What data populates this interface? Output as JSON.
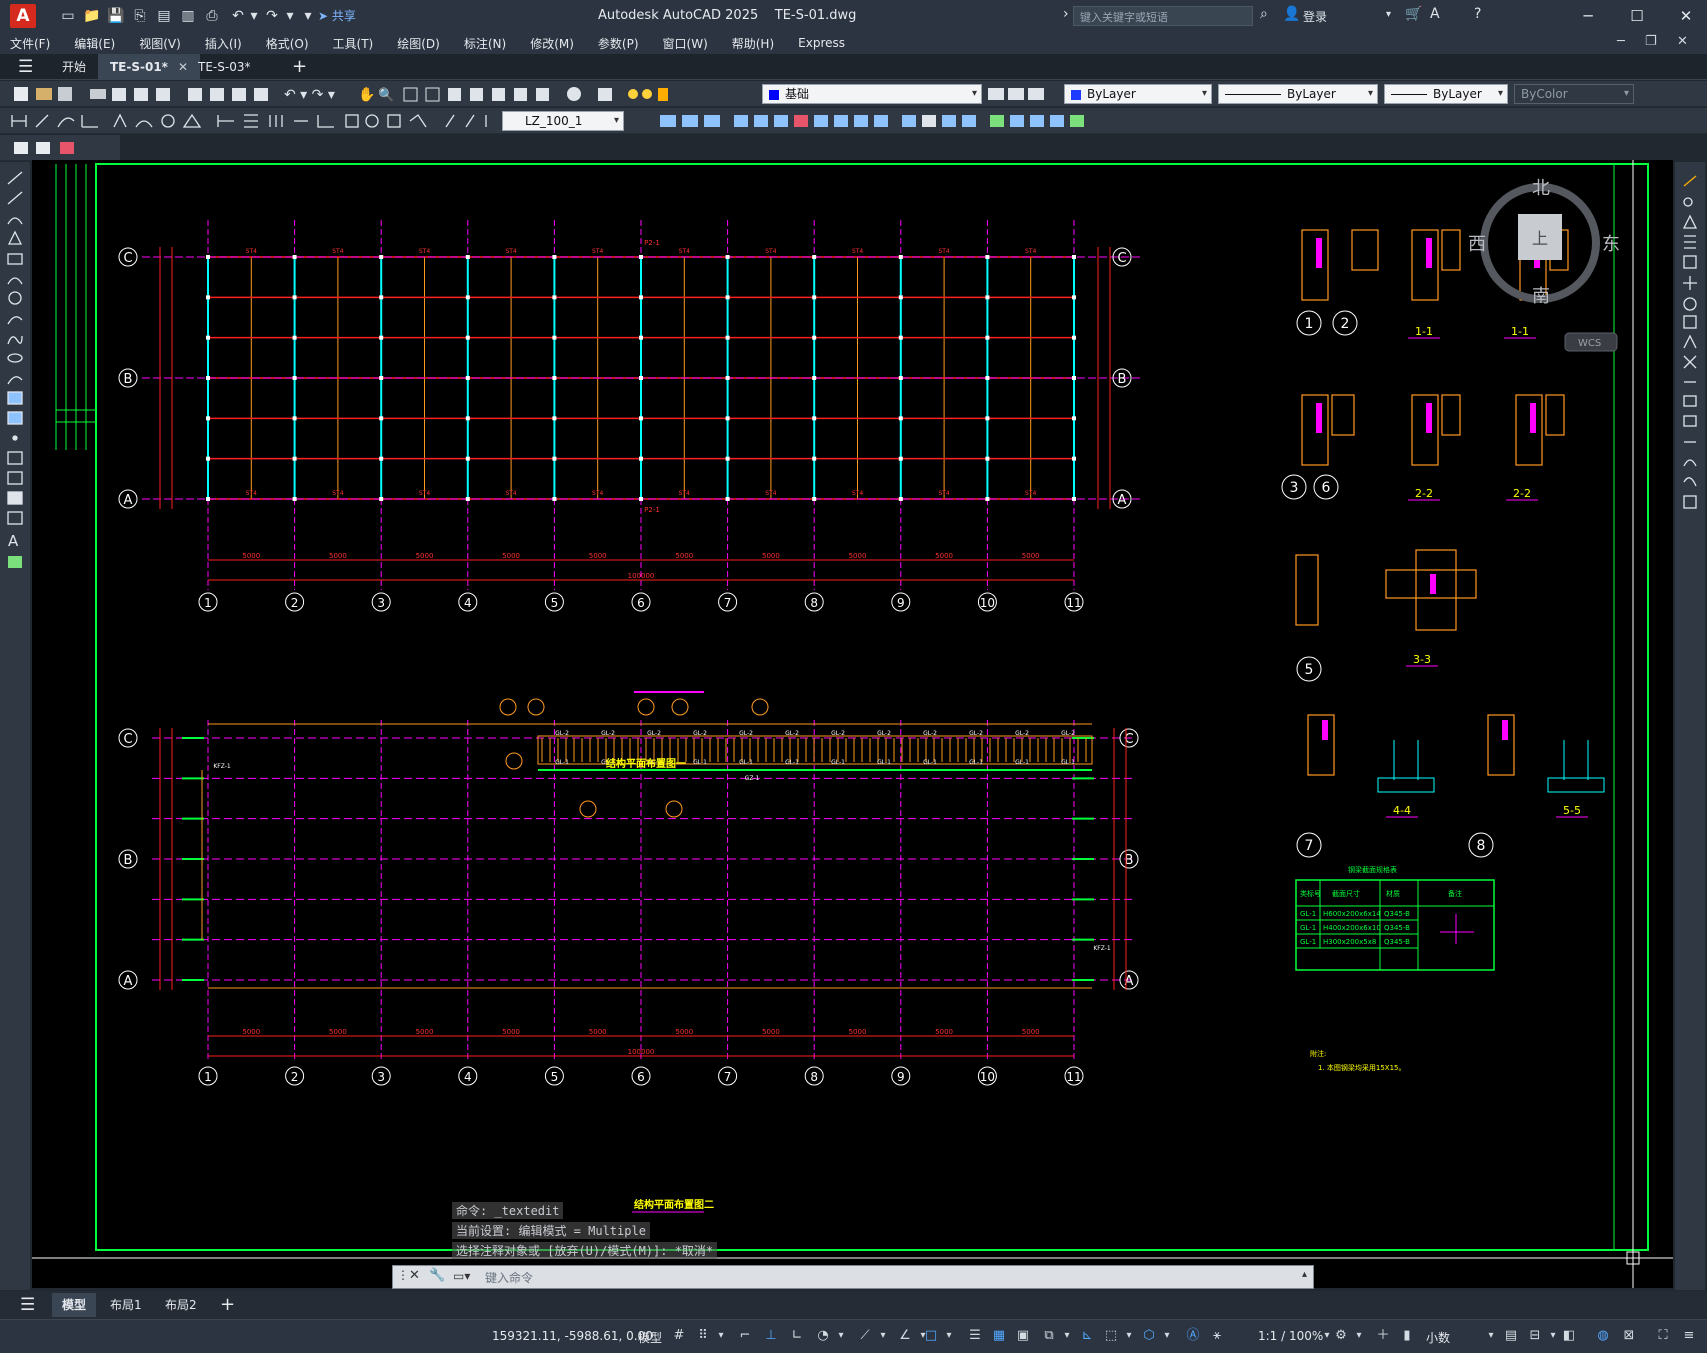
{
  "titlebar": {
    "logo": "A",
    "app_title": "Autodesk AutoCAD 2025    TE-S-01.dwg",
    "share": "共享",
    "search_placeholder": "键入关键字或短语",
    "signin": "登录"
  },
  "menu": [
    "文件(F)",
    "编辑(E)",
    "视图(V)",
    "插入(I)",
    "格式(O)",
    "工具(T)",
    "绘图(D)",
    "标注(N)",
    "修改(M)",
    "参数(P)",
    "窗口(W)",
    "帮助(H)",
    "Express"
  ],
  "file_tabs": {
    "start": "开始",
    "tabs": [
      {
        "label": "TE-S-01*",
        "active": true
      },
      {
        "label": "TE-S-03*",
        "active": false
      }
    ]
  },
  "properties": {
    "layer": "基础",
    "layer_color": "#0000ff",
    "color": "ByLayer",
    "linetype": "ByLayer",
    "lineweight": "ByLayer",
    "plotstyle": "ByColor",
    "dimstyle": "LZ_100_1"
  },
  "drawing": {
    "plan1": {
      "grid_rows": [
        "C",
        "B",
        "A"
      ],
      "grid_cols": [
        "1",
        "2",
        "3",
        "4",
        "5",
        "6",
        "7",
        "8",
        "9",
        "10",
        "11"
      ],
      "bay_dim": "5000",
      "total_dim": "100000",
      "tie_label": "ST4",
      "beam_label": "P2-1"
    },
    "plan2": {
      "title": "结构平面布置图一",
      "caption": "结构平面布置图二",
      "labels": [
        "GL-2",
        "GL-1",
        "KFZ-1",
        "GZ-1",
        "KFZ-1"
      ]
    },
    "details": [
      {
        "marks": [
          "1",
          "2"
        ],
        "sections": [
          "1-1",
          "1-1"
        ]
      },
      {
        "marks": [
          "3",
          "6"
        ],
        "sections": [
          "2-2",
          "2-2"
        ]
      },
      {
        "marks": [
          "5"
        ],
        "sections": [
          "3-3"
        ]
      },
      {
        "marks": [
          "7",
          "8"
        ],
        "sections": [
          "4-4",
          "5-5"
        ]
      }
    ],
    "table": {
      "title": "钢梁截面规格表",
      "headers": [
        "类标号",
        "截面尺寸",
        "材质",
        "备注"
      ],
      "rows": [
        [
          "GL-1",
          "H600x200x6x14",
          "Q345-B"
        ],
        [
          "GL-1",
          "H400x200x6x10",
          "Q345-B"
        ],
        [
          "GL-1",
          "H300x200x5x8",
          "Q345-B"
        ]
      ]
    },
    "notes": {
      "title": "附注:",
      "line1": "1.  本图钢梁均采用15X15。"
    }
  },
  "viewcube": {
    "north": "北",
    "south": "南",
    "east": "东",
    "west": "西",
    "top": "上",
    "wcs": "WCS"
  },
  "command": {
    "history": [
      "命令: _textedit",
      "当前设置: 编辑模式 = Multiple",
      "选择注释对象或 [放弃(U)/模式(M)]: *取消*"
    ],
    "placeholder": "键入命令"
  },
  "layout_tabs": {
    "tabs": [
      "模型",
      "布局1",
      "布局2"
    ],
    "active": "模型"
  },
  "status": {
    "coords": "159321.11, -5988.61, 0.00",
    "space": "模型",
    "scale": "1:1 / 100%",
    "units": "小数"
  }
}
